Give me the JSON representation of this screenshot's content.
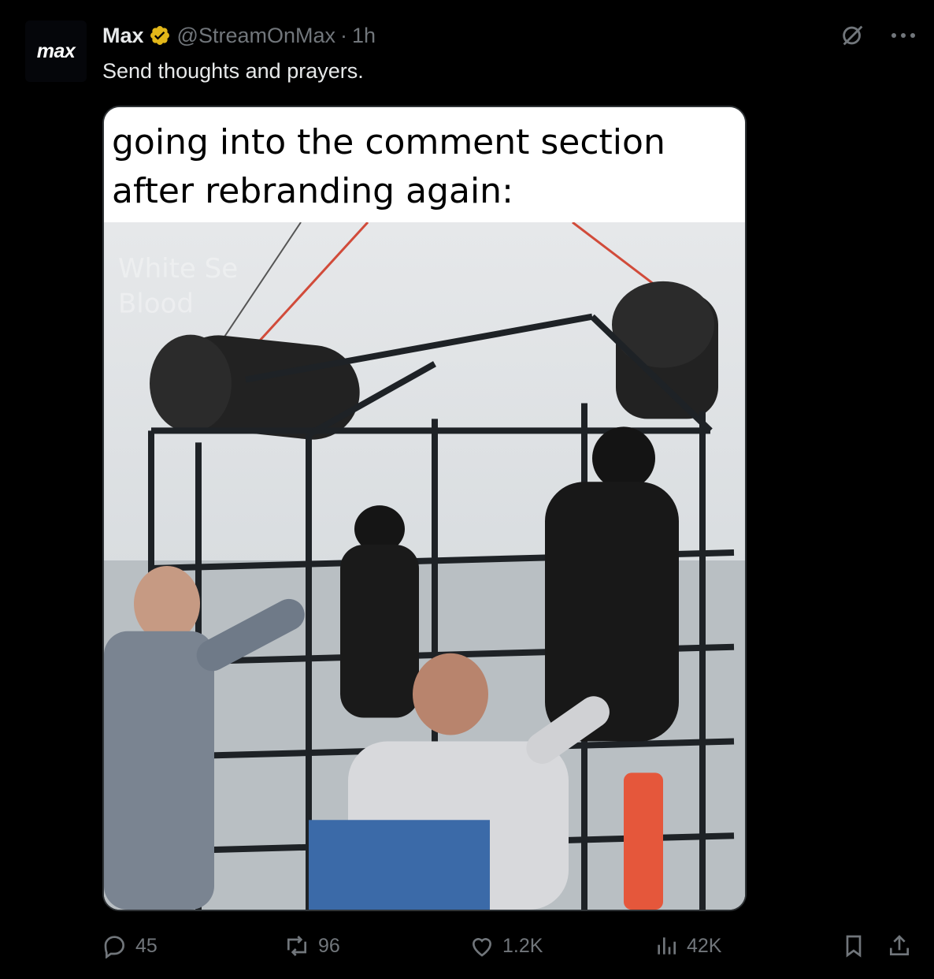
{
  "tweet": {
    "avatar_text": "max",
    "display_name": "Max",
    "handle": "@StreamOnMax",
    "separator": "·",
    "time": "1h",
    "text": "Send thoughts and prayers.",
    "media": {
      "caption_line1": "going into the comment section",
      "caption_line2": "after rebranding again:",
      "watermark_line1": "White Se",
      "watermark_line2": "Blood"
    }
  },
  "actions": {
    "replies": "45",
    "reposts": "96",
    "likes": "1.2K",
    "views": "42K"
  },
  "icons": {
    "verified": "verified-badge-icon",
    "grok": "grok-icon",
    "more": "more-icon",
    "reply": "reply-icon",
    "repost": "repost-icon",
    "like": "like-icon",
    "views": "views-icon",
    "bookmark": "bookmark-icon",
    "share": "share-icon"
  },
  "colors": {
    "background": "#000000",
    "text_primary": "#e7e9ea",
    "text_secondary": "#71767b",
    "verified_gold": "#e2b719"
  }
}
